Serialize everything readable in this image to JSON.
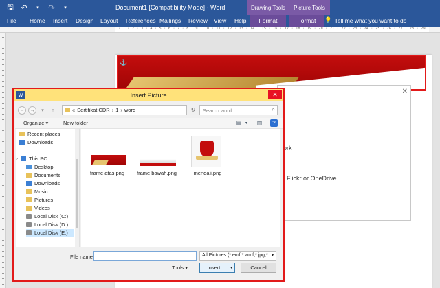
{
  "window": {
    "title": "Document1 [Compatibility Mode] - Word",
    "context_drawing": "Drawing Tools",
    "context_picture": "Picture Tools"
  },
  "ribbon": {
    "tabs": [
      "File",
      "Home",
      "Insert",
      "Design",
      "Layout",
      "References",
      "Mailings",
      "Review",
      "View",
      "Help",
      "Format",
      "Format"
    ],
    "tell_me": "Tell me what you want to do"
  },
  "ruler": {
    "marks": "· 1 · 2 · 3 · 4 · 5 · 6 · 7 · 8 · 9 · 10 · 11 · 12 · 13 · 14 · 15 · 16 · 17 · 18 · 19 · 20 · 21 · 22 · 23 · 24 · 25 · 26 · 27 · 28 · 29"
  },
  "online_panel": {
    "line1": "ork",
    "line2": ", Flickr or OneDrive"
  },
  "dialog": {
    "title": "Insert Picture",
    "breadcrumb": [
      "«",
      "Sertifikat CDR",
      "›",
      "1",
      "›",
      "word"
    ],
    "search_placeholder": "Search word",
    "toolbar": {
      "organize": "Organize ▾",
      "new_folder": "New folder"
    },
    "nav_items": [
      {
        "label": "Recent places",
        "kind": "folder"
      },
      {
        "label": "Downloads",
        "kind": "dl"
      },
      {
        "label": "This PC",
        "kind": "pc"
      },
      {
        "label": "Desktop",
        "kind": "folder"
      },
      {
        "label": "Documents",
        "kind": "folder"
      },
      {
        "label": "Downloads",
        "kind": "dl"
      },
      {
        "label": "Music",
        "kind": "folder"
      },
      {
        "label": "Pictures",
        "kind": "folder"
      },
      {
        "label": "Videos",
        "kind": "folder"
      },
      {
        "label": "Local Disk (C:)",
        "kind": "disk"
      },
      {
        "label": "Local Disk (D:)",
        "kind": "disk"
      },
      {
        "label": "Local Disk (E:)",
        "kind": "disk"
      }
    ],
    "files": [
      "frame atas.png",
      "frame bawah.png",
      "mendali.png"
    ],
    "file_name_label": "File name:",
    "file_name_value": "",
    "file_type": "All Pictures (*.emf;*.wmf;*.jpg;*",
    "tools_label": "Tools",
    "insert_label": "Insert",
    "cancel_label": "Cancel"
  }
}
